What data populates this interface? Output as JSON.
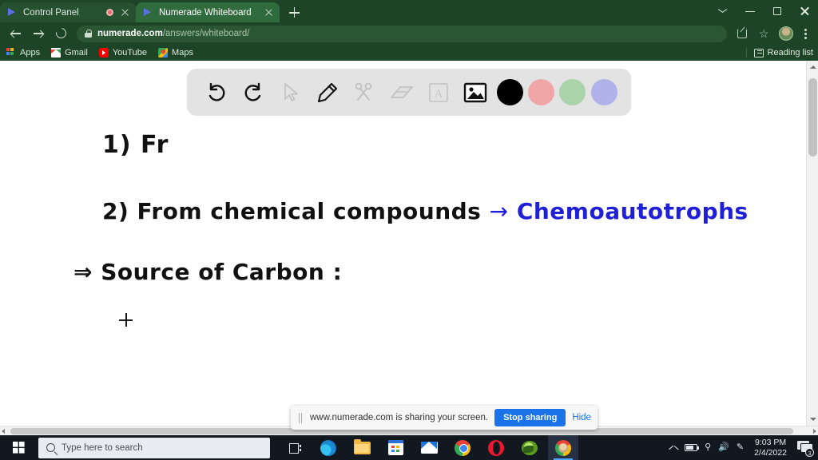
{
  "browser": {
    "tabs": [
      {
        "title": "Control Panel",
        "active": false,
        "recording": true
      },
      {
        "title": "Numerade Whiteboard",
        "active": true,
        "recording": false
      }
    ],
    "new_tab_label": "+",
    "address": {
      "host": "numerade.com",
      "path": "/answers/whiteboard/",
      "lock_icon": "lock-icon"
    },
    "nav": {
      "back": "back-arrow-icon",
      "forward": "forward-arrow-icon",
      "reload": "reload-icon"
    },
    "omnibox_actions": {
      "share": "share-icon",
      "bookmark": "star-icon",
      "profile": "avatar",
      "menu": "kebab-menu-icon"
    },
    "bookmarks": [
      {
        "label": "Apps",
        "icon": "apps-grid-icon"
      },
      {
        "label": "Gmail",
        "icon": "gmail-icon"
      },
      {
        "label": "YouTube",
        "icon": "youtube-icon"
      },
      {
        "label": "Maps",
        "icon": "maps-icon"
      }
    ],
    "reading_list": {
      "label": "Reading list",
      "icon": "reading-list-icon"
    },
    "window_controls": {
      "collapse": "chevron-down-icon",
      "minimize": "minimize-icon",
      "maximize": "maximize-icon",
      "close": "close-icon"
    }
  },
  "whiteboard": {
    "toolbar": {
      "tools": [
        {
          "name": "undo-icon",
          "label": "Undo",
          "state": "enabled"
        },
        {
          "name": "redo-icon",
          "label": "Redo",
          "state": "enabled"
        },
        {
          "name": "pointer-icon",
          "label": "Select",
          "state": "disabled"
        },
        {
          "name": "pencil-icon",
          "label": "Pen",
          "state": "active"
        },
        {
          "name": "scissors-icon",
          "label": "Cut",
          "state": "disabled"
        },
        {
          "name": "eraser-icon",
          "label": "Eraser",
          "state": "disabled"
        },
        {
          "name": "text-icon",
          "label": "Text",
          "state": "disabled"
        },
        {
          "name": "image-icon",
          "label": "Image",
          "state": "enabled"
        }
      ],
      "colors": [
        {
          "name": "color-black",
          "hex": "#000000",
          "selected": true
        },
        {
          "name": "color-pink",
          "hex": "#f0a6a6",
          "selected": false
        },
        {
          "name": "color-green",
          "hex": "#a9d3a8",
          "selected": false
        },
        {
          "name": "color-purple",
          "hex": "#b2b2ea",
          "selected": false
        }
      ],
      "background": "#e3e3e3"
    },
    "notes": {
      "line1": "1)  Fr",
      "line2_black": "2)   From chemical compounds",
      "line2_arrow": "→",
      "line2_blue": "Chemoautotrophs",
      "line3": "⇒   Source  of  Carbon :",
      "blue_hex": "#1f1fd8",
      "ink_hex": "#111111"
    },
    "cursor": "crosshair-cursor"
  },
  "share_bar": {
    "grip": "drag-grip-icon",
    "message": "www.numerade.com is sharing your screen.",
    "stop_label": "Stop sharing",
    "hide_label": "Hide",
    "accent_hex": "#1a73e8"
  },
  "scrollbars": {
    "vertical": "vertical-scrollbar",
    "horizontal": "horizontal-scrollbar"
  },
  "taskbar": {
    "start": "windows-start-icon",
    "search_placeholder": "Type here to search",
    "task_view": "task-view-icon",
    "apps": [
      {
        "name": "edge-icon",
        "active": false
      },
      {
        "name": "explorer-icon",
        "active": false
      },
      {
        "name": "store-icon",
        "active": false
      },
      {
        "name": "mail-icon",
        "active": false
      },
      {
        "name": "chrome-icon",
        "active": false
      },
      {
        "name": "opera-icon",
        "active": false
      },
      {
        "name": "nvidia-icon",
        "active": false
      },
      {
        "name": "chrome-whiteboard-icon",
        "active": true
      }
    ],
    "tray": {
      "show_hidden": "chevron-up-icon",
      "battery": "battery-icon",
      "wifi": "wifi-icon",
      "volume": "volume-icon",
      "pen": "pen-icon"
    },
    "clock": {
      "time": "9:03 PM",
      "date": "2/4/2022"
    },
    "notifications": {
      "icon": "notification-icon",
      "count": "3"
    }
  }
}
